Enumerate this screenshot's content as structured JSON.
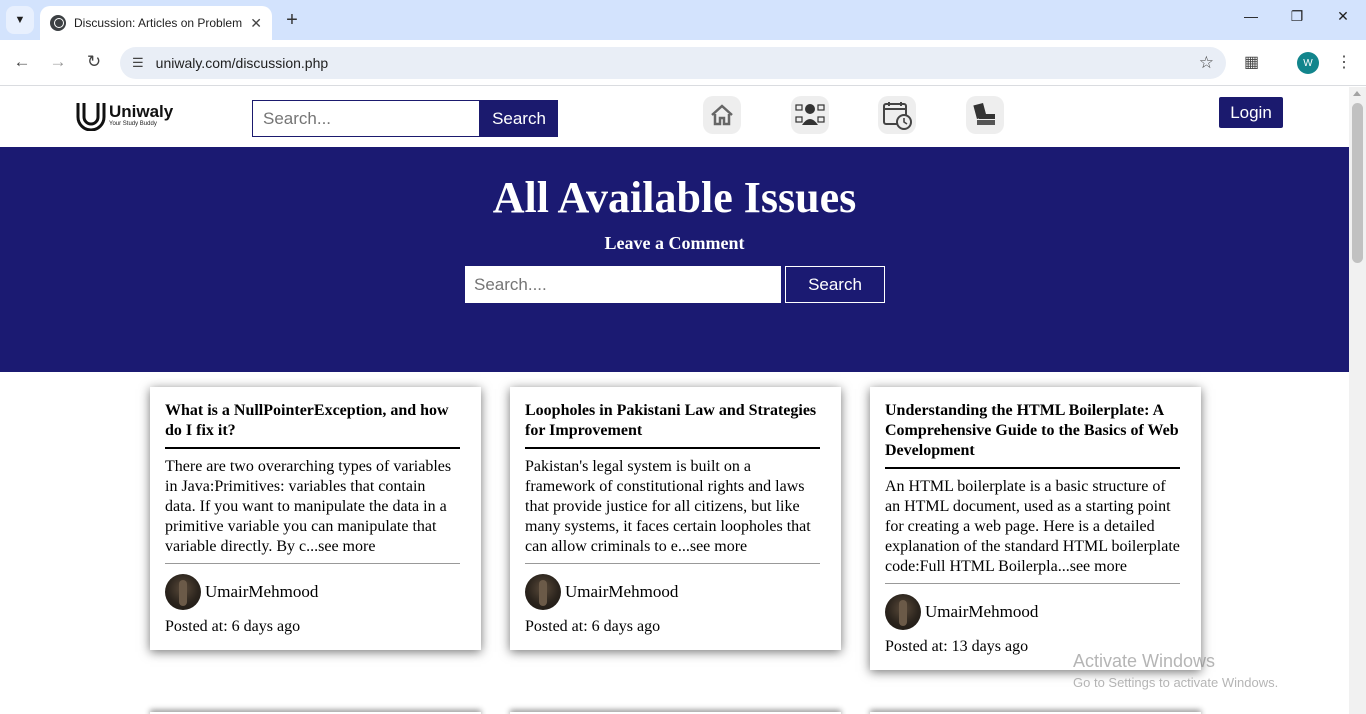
{
  "browser": {
    "tab_title": "Discussion: Articles on Problem",
    "tab_close": "✕",
    "new_tab": "+",
    "url": "uniwaly.com/discussion.php",
    "profile_initial": "W"
  },
  "navbar": {
    "logo_name": "Uniwaly",
    "logo_tagline": "Your Study Buddy",
    "search_placeholder": "Search...",
    "search_button": "Search",
    "icons": [
      "home-icon",
      "teacher-icon",
      "schedule-icon",
      "books-icon"
    ],
    "login": "Login"
  },
  "hero": {
    "title": "All Available Issues",
    "subtitle": "Leave a Comment",
    "search_placeholder": "Search....",
    "search_button": "Search",
    "background": "#1b1a72"
  },
  "posts": [
    {
      "title": "What is a NullPointerException, and how do I fix it?",
      "excerpt": "There are two overarching types of variables in Java:Primitives: variables that contain data. If you want to manipulate the data in a primitive variable you can manipulate that variable directly. By c...see more",
      "author": "UmairMehmood",
      "posted": "Posted at: 6 days ago"
    },
    {
      "title": "Loopholes in Pakistani Law and Strategies for Improvement",
      "excerpt": "Pakistan's legal system is built on a framework of constitutional rights and laws that provide justice for all citizens, but like many systems, it faces certain loopholes that can allow criminals to e...see more",
      "author": "UmairMehmood",
      "posted": "Posted at: 6 days ago"
    },
    {
      "title": "Understanding the HTML Boilerplate: A Comprehensive Guide to the Basics of Web Development",
      "excerpt": "An HTML boilerplate is a basic structure of an HTML document, used as a starting point for creating a web page. Here is a detailed explanation of the standard HTML boilerplate code:Full HTML Boilerpla...see more",
      "author": "UmairMehmood",
      "posted": "Posted at: 13 days ago"
    }
  ],
  "watermark": {
    "line1": "Activate Windows",
    "line2": "Go to Settings to activate Windows."
  }
}
